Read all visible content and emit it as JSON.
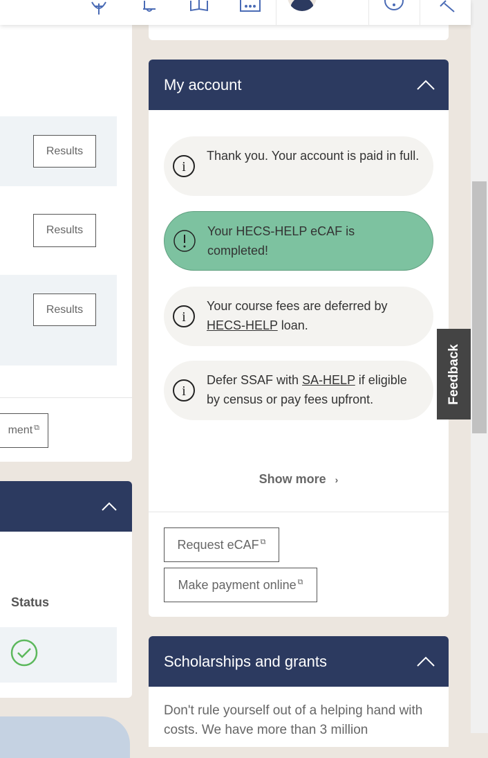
{
  "topbar": {
    "icons": [
      "globe-icon",
      "bell-icon",
      "book-icon",
      "calendar-icon",
      "avatar",
      "help-icon",
      "search-icon"
    ]
  },
  "left": {
    "results_buttons": [
      "Results",
      "Results",
      "Results"
    ],
    "footer_button": "ment",
    "status_header": "Status",
    "status_value": "completed",
    "pill_text": "..."
  },
  "my_account": {
    "title": "My account",
    "alerts": [
      {
        "type": "info",
        "text": "Thank you. Your account is paid in full."
      },
      {
        "type": "success",
        "text": "Your HECS-HELP eCAF is completed!"
      },
      {
        "type": "info",
        "text_before": "Your course fees are deferred by ",
        "link": "HECS-HELP",
        "text_after": " loan."
      },
      {
        "type": "info",
        "text_before": "Defer SSAF with ",
        "link": "SA-HELP",
        "text_after": " if eligible by census or pay fees upfront."
      }
    ],
    "show_more": "Show more",
    "buttons": [
      "Request eCAF",
      "Make payment online"
    ]
  },
  "scholarships": {
    "title": "Scholarships and grants",
    "text": "Don't rule yourself out of a helping hand with costs. We have more than 3 million"
  },
  "feedback": "Feedback",
  "colors": {
    "header": "#2c3a60",
    "success": "#7dc2a0",
    "accent": "#4a6bb5"
  }
}
